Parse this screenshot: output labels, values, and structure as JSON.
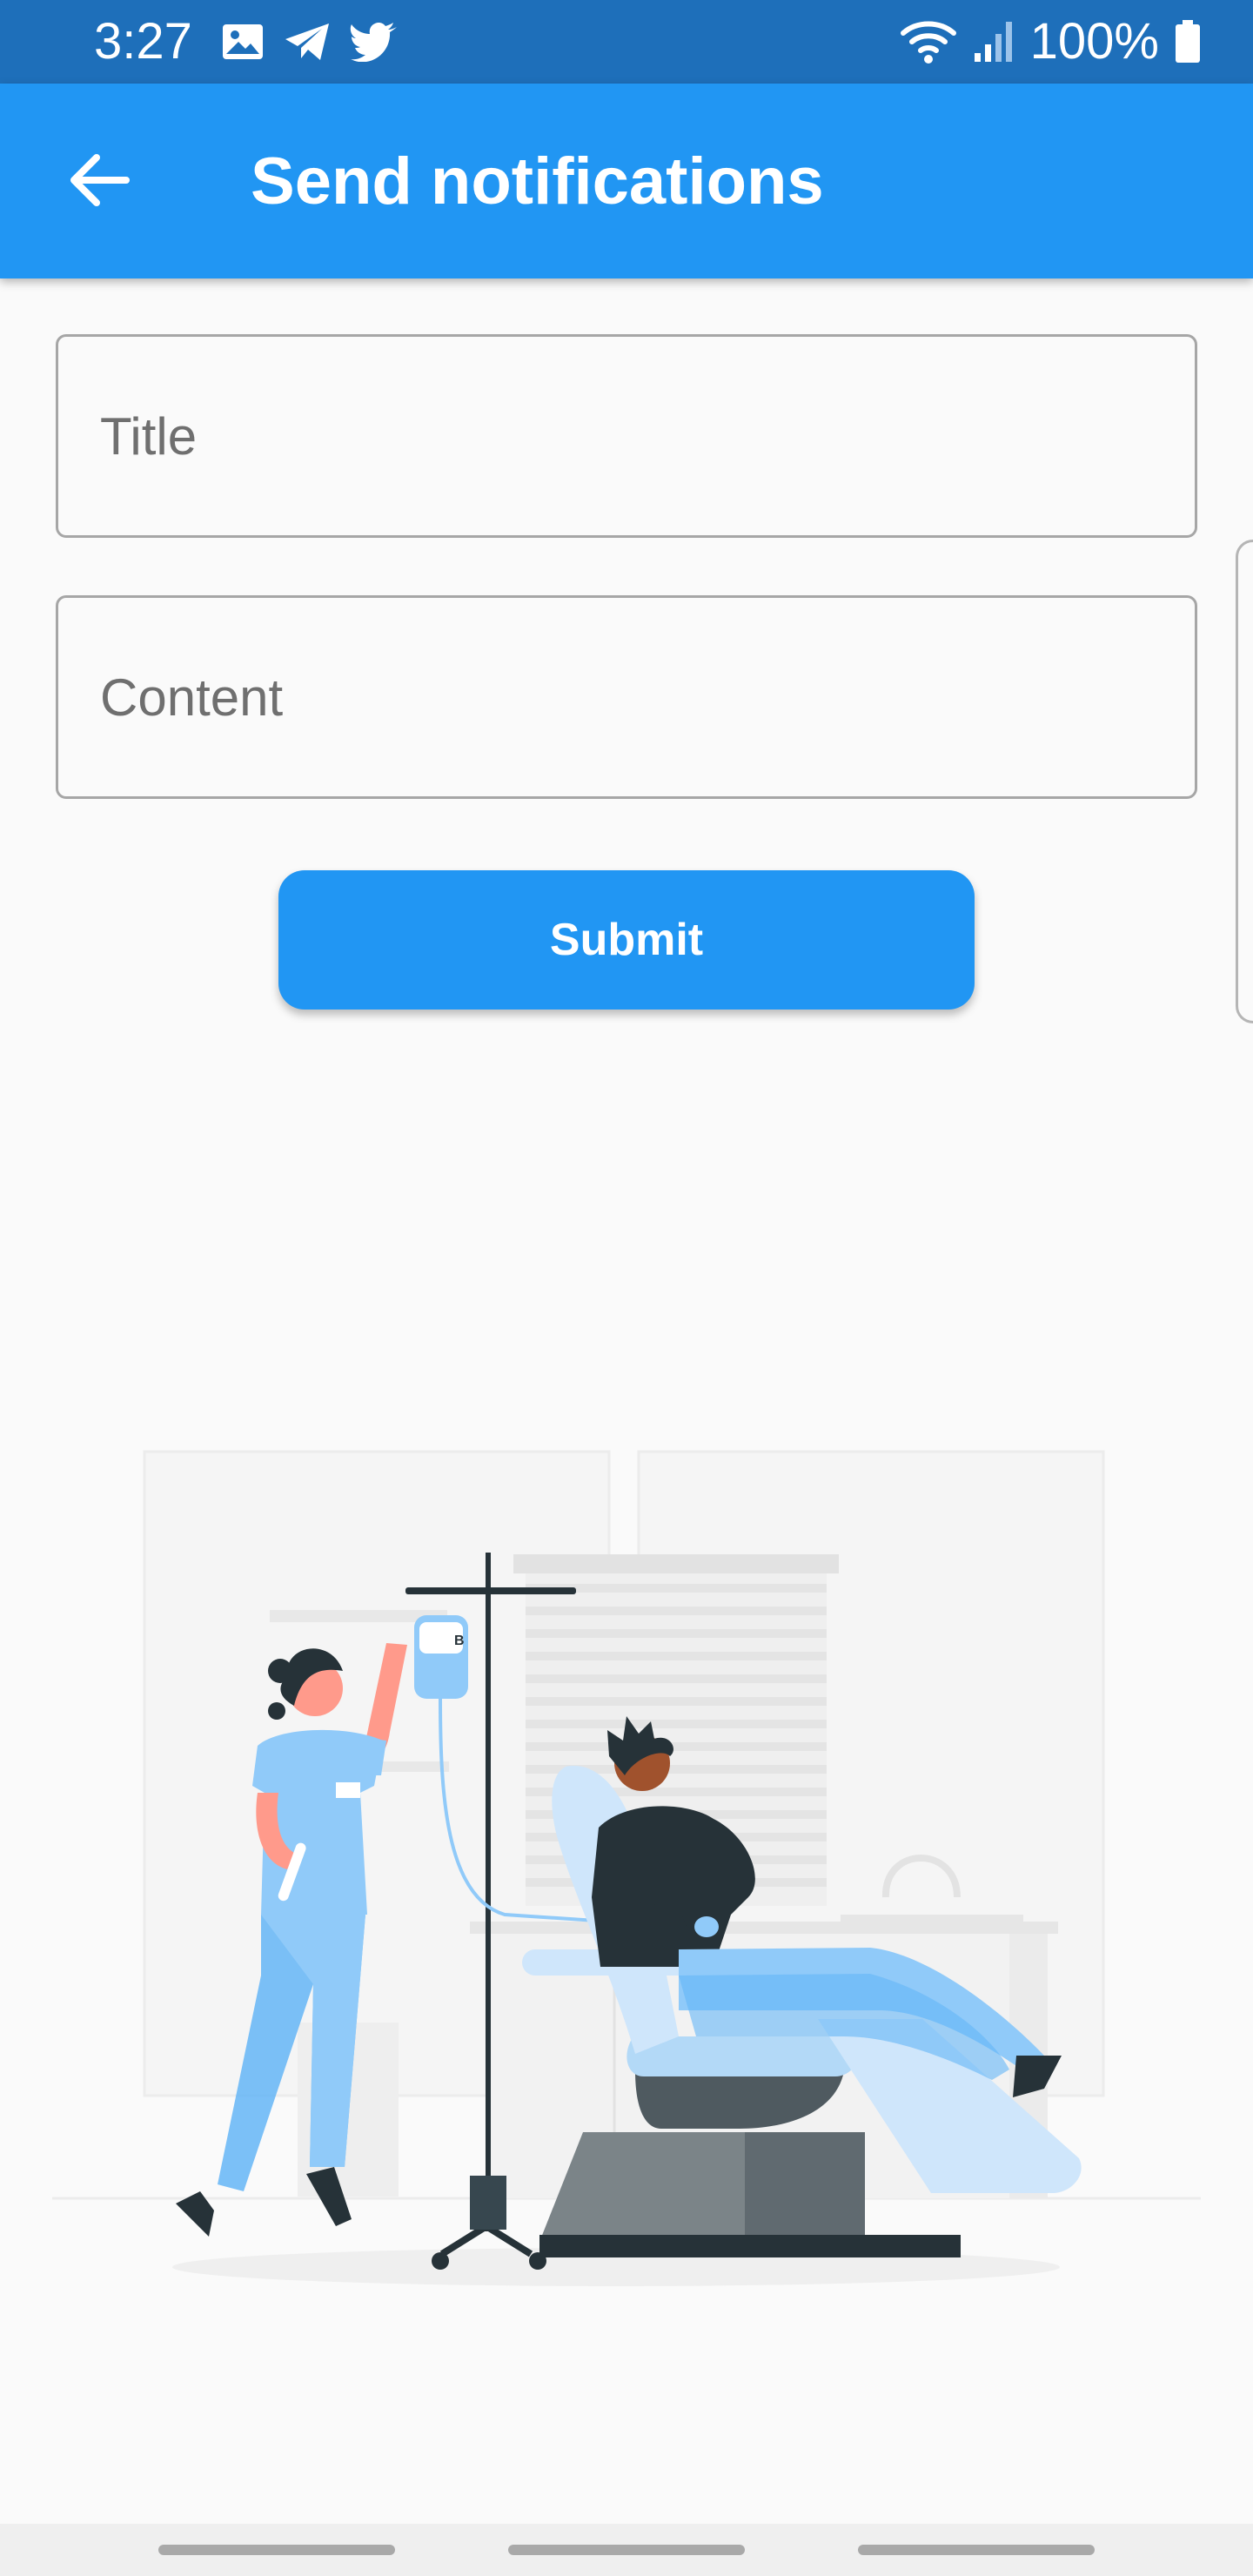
{
  "status_bar": {
    "time": "3:27",
    "battery_text": "100%",
    "icons_left": [
      "image-icon",
      "telegram-icon",
      "twitter-icon"
    ],
    "icons_right": [
      "wifi-icon",
      "signal-icon",
      "battery-icon"
    ]
  },
  "app_bar": {
    "back_icon": "arrow-left-icon",
    "title": "Send notifications"
  },
  "form": {
    "title_placeholder": "Title",
    "title_value": "",
    "content_placeholder": "Content",
    "content_value": "",
    "submit_label": "Submit"
  },
  "illustration": {
    "bag_label": "B"
  },
  "colors": {
    "status_bar": "#1e6fba",
    "app_bar": "#2196f3",
    "accent": "#2196f3",
    "background": "#fafafa"
  }
}
